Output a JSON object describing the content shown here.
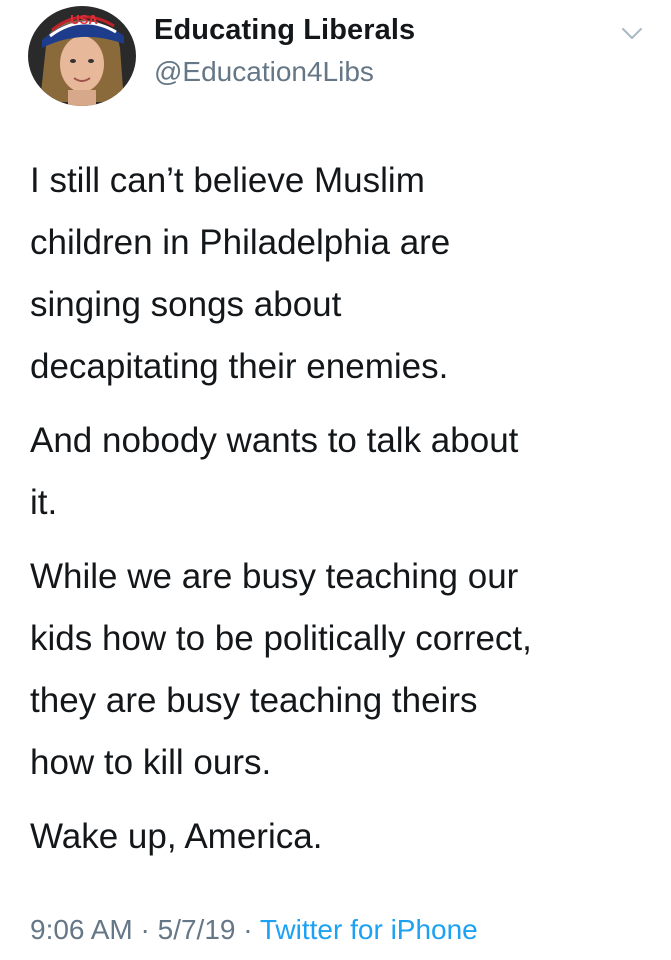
{
  "header": {
    "avatar_flag_text": "USA",
    "display_name": "Educating Liberals",
    "handle": "@Education4Libs"
  },
  "tweet": {
    "paragraphs": [
      "I still can’t believe Muslim\nchildren in Philadelphia are\nsinging songs about\ndecapitating their enemies.",
      "And nobody wants to talk about\nit.",
      "While we are busy teaching our\nkids how to be politically correct,\nthey are busy teaching theirs\nhow to kill ours.",
      "Wake up, America."
    ]
  },
  "meta": {
    "time": "9:06 AM",
    "separator": " · ",
    "date": "5/7/19",
    "source": "Twitter for iPhone"
  },
  "colors": {
    "text": "#14171a",
    "secondary": "#657786",
    "link": "#1da1f2"
  },
  "icons": {
    "menu": "chevron-down-icon"
  }
}
